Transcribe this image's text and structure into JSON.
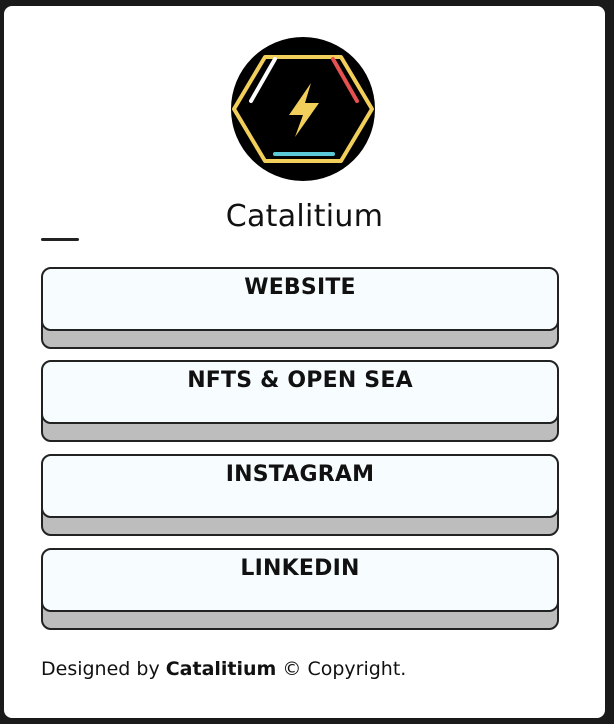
{
  "profile": {
    "name": "Catalitium"
  },
  "links": [
    {
      "label": "WEBSITE"
    },
    {
      "label": "NFTS & OPEN SEA"
    },
    {
      "label": "INSTAGRAM"
    },
    {
      "label": "LINKEDIN"
    }
  ],
  "footer": {
    "prefix": "Designed by ",
    "brand": "Catalitium",
    "suffix": " © Copyright."
  },
  "colors": {
    "logo_background": "#000000",
    "hexagon": "#f2cf5a",
    "bolt": "#f2cf5a",
    "accent_red": "#e55050",
    "accent_cyan": "#5bc8d8",
    "accent_white": "#ffffff",
    "button_face": "#f7fcff",
    "button_shadow": "#bdbdbd"
  },
  "icons": {
    "logo": "lightning-bolt-hexagon-icon"
  }
}
